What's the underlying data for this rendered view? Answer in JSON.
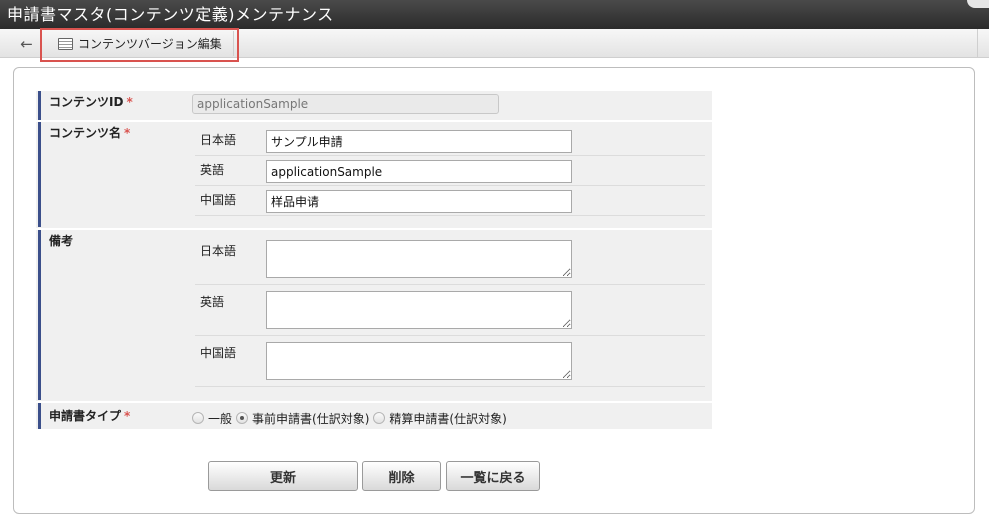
{
  "window": {
    "title": "申請書マスタ(コンテンツ定義)メンテナンス"
  },
  "toolbar": {
    "back_icon": "←",
    "version_button_label": "コンテンツバージョン編集"
  },
  "form": {
    "content_id": {
      "label": "コンテンツID",
      "required_mark": "*",
      "value": "applicationSample"
    },
    "content_name": {
      "label": "コンテンツ名",
      "required_mark": "*",
      "langs": [
        {
          "label": "日本語",
          "value": "サンプル申請"
        },
        {
          "label": "英語",
          "value": "applicationSample"
        },
        {
          "label": "中国語",
          "value": "样品申请"
        }
      ]
    },
    "remarks": {
      "label": "備考",
      "langs": [
        {
          "label": "日本語",
          "value": ""
        },
        {
          "label": "英語",
          "value": ""
        },
        {
          "label": "中国語",
          "value": ""
        }
      ]
    },
    "application_type": {
      "label": "申請書タイプ",
      "required_mark": "*",
      "options": [
        {
          "label": "一般",
          "selected": false
        },
        {
          "label": "事前申請書(仕訳対象)",
          "selected": true
        },
        {
          "label": "精算申請書(仕訳対象)",
          "selected": false
        }
      ]
    }
  },
  "buttons": {
    "update": "更新",
    "delete": "削除",
    "back_to_list": "一覧に戻る"
  },
  "colors": {
    "title_bar": "#333333",
    "label_accent": "#3b4f8a",
    "required": "#d9534f",
    "highlight": "#d9534f"
  }
}
